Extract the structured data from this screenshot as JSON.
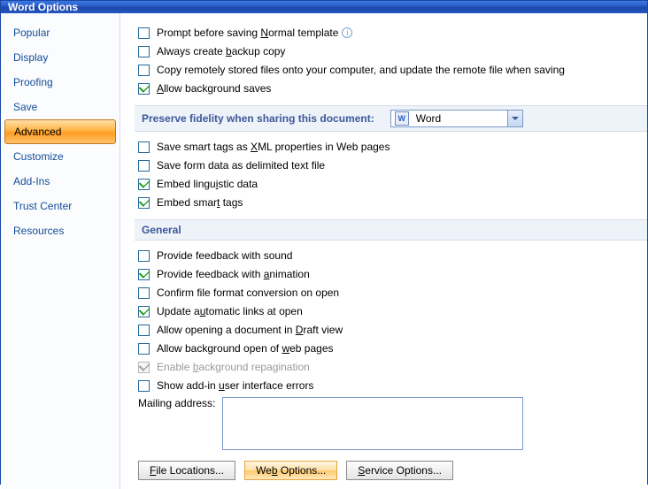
{
  "window": {
    "title": "Word Options"
  },
  "sidebar": {
    "items": [
      {
        "label": "Popular",
        "selected": false
      },
      {
        "label": "Display",
        "selected": false
      },
      {
        "label": "Proofing",
        "selected": false
      },
      {
        "label": "Save",
        "selected": false
      },
      {
        "label": "Advanced",
        "selected": true
      },
      {
        "label": "Customize",
        "selected": false
      },
      {
        "label": "Add-Ins",
        "selected": false
      },
      {
        "label": "Trust Center",
        "selected": false
      },
      {
        "label": "Resources",
        "selected": false
      }
    ]
  },
  "topChecks": {
    "promptNormal": {
      "label_pre": "Prompt before saving ",
      "u": "N",
      "label_post": "ormal template",
      "checked": false,
      "info": true
    },
    "alwaysBackup": {
      "label_pre": "Always create ",
      "u": "b",
      "label_post": "ackup copy",
      "checked": false
    },
    "copyRemote": {
      "label_pre": "Copy remotely stored files onto your computer, and update the remote file when saving",
      "u": "",
      "label_post": "",
      "checked": false
    },
    "allowBgSaves": {
      "label_pre": "",
      "u": "A",
      "label_post": "llow background saves",
      "checked": true
    }
  },
  "preserve": {
    "header": "Preserve fidelity when sharing this document:",
    "comboIcon": "W",
    "comboText": "Word"
  },
  "fidelityChecks": {
    "saveSmartXml": {
      "label_pre": "Save smart tags as ",
      "u": "X",
      "label_post": "ML properties in Web pages",
      "checked": false
    },
    "saveFormData": {
      "label_pre": "Save form data as delimited text file",
      "u": "",
      "label_post": "",
      "checked": false
    },
    "embedLing": {
      "label_pre": "Embed lingu",
      "u": "i",
      "label_post": "stic data",
      "checked": true
    },
    "embedSmart": {
      "label_pre": "Embed smar",
      "u": "t",
      "label_post": " tags",
      "checked": true
    }
  },
  "general": {
    "header": "General",
    "feedbackSound": {
      "label_pre": "Provide feedback with sound",
      "u": "",
      "label_post": "",
      "checked": false
    },
    "feedbackAnim": {
      "label_pre": "Provide feedback with ",
      "u": "a",
      "label_post": "nimation",
      "checked": true
    },
    "confirmConvert": {
      "label_pre": "Confirm file format conversion on open",
      "u": "",
      "label_post": "",
      "checked": false
    },
    "updateLinks": {
      "label_pre": "Update a",
      "u": "u",
      "label_post": "tomatic links at open",
      "checked": true
    },
    "allowDraft": {
      "label_pre": "Allow opening a document in ",
      "u": "D",
      "label_post": "raft view",
      "checked": false
    },
    "allowBgOpen": {
      "label_pre": "Allow background open of ",
      "u": "w",
      "label_post": "eb pages",
      "checked": false
    },
    "enableRepag": {
      "label_pre": "Enable ",
      "u": "b",
      "label_post": "ackground repagination",
      "checked": true,
      "disabled": true
    },
    "showAddinErr": {
      "label_pre": "Show add-in ",
      "u": "u",
      "label_post": "ser interface errors",
      "checked": false
    },
    "mailingLabel": "Mailing address:",
    "mailingValue": ""
  },
  "buttons": {
    "fileLocations": {
      "u": "F",
      "rest": "ile Locations..."
    },
    "webOptions": {
      "pre": "We",
      "u": "b",
      "rest": " Options..."
    },
    "serviceOptions": {
      "u": "S",
      "rest": "ervice Options..."
    }
  }
}
